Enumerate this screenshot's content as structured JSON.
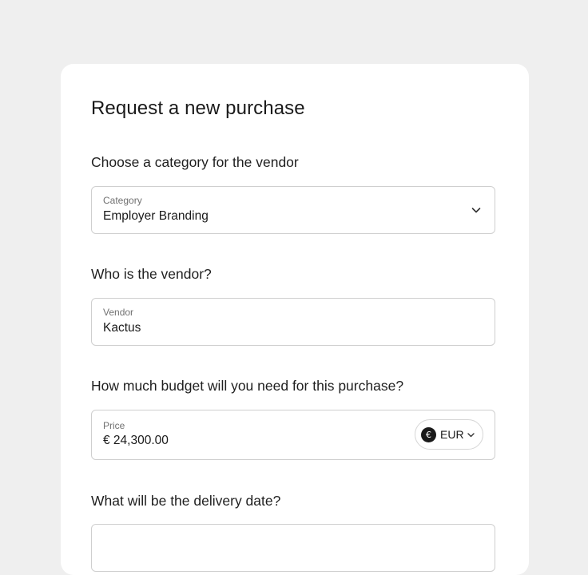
{
  "form": {
    "title": "Request a new purchase",
    "category_section": {
      "question": "Choose a category for the vendor",
      "label": "Category",
      "value": "Employer Branding",
      "icon": "chevron-down-icon"
    },
    "vendor_section": {
      "question": "Who is the vendor?",
      "label": "Vendor",
      "value": "Kactus"
    },
    "budget_section": {
      "question": "How much budget will you need for this purchase?",
      "label": "Price",
      "value": "€ 24,300.00",
      "currency": {
        "symbol": "€",
        "code": "EUR",
        "icon": "chevron-down-icon"
      }
    },
    "delivery_section": {
      "question": "What will be the delivery date?"
    }
  },
  "colors": {
    "page_background": "#efefef",
    "card_background": "#ffffff",
    "field_border": "#cfcfcf",
    "label_text": "#707070",
    "primary_text": "#1a1a1a"
  }
}
